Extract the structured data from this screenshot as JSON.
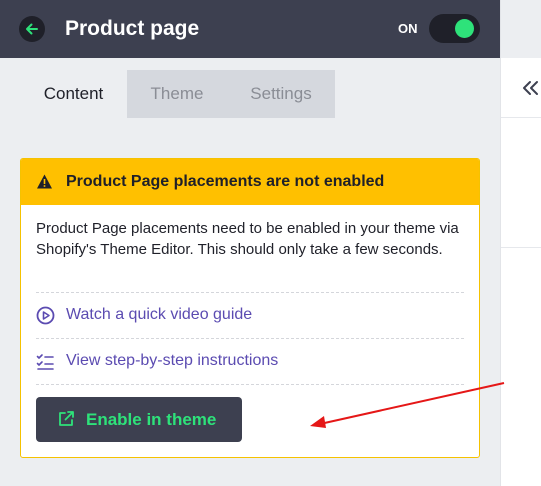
{
  "header": {
    "title": "Product page",
    "toggle_label": "ON",
    "toggle_on": true,
    "back_icon": "arrow-left-icon"
  },
  "tabs": [
    {
      "label": "Content",
      "active": true
    },
    {
      "label": "Theme",
      "active": false
    },
    {
      "label": "Settings",
      "active": false
    }
  ],
  "notice": {
    "title": "Product Page placements are not enabled",
    "icon": "warning-icon",
    "description": "Product Page placements need to be enabled in your theme via Shopify's Theme Editor. This should only take a few seconds.",
    "links": [
      {
        "label": "Watch a quick video guide",
        "icon": "play-circle-icon"
      },
      {
        "label": "View step-by-step instructions",
        "icon": "checklist-icon"
      }
    ],
    "button_label": "Enable in theme",
    "button_icon": "external-link-icon"
  },
  "colors": {
    "header_bg": "#3d4050",
    "panel_bg": "#eceef1",
    "accent_green": "#2ee27a",
    "warning_yellow": "#ffc000",
    "link_purple": "#5b4bb1",
    "annotation_red": "#e51717"
  }
}
